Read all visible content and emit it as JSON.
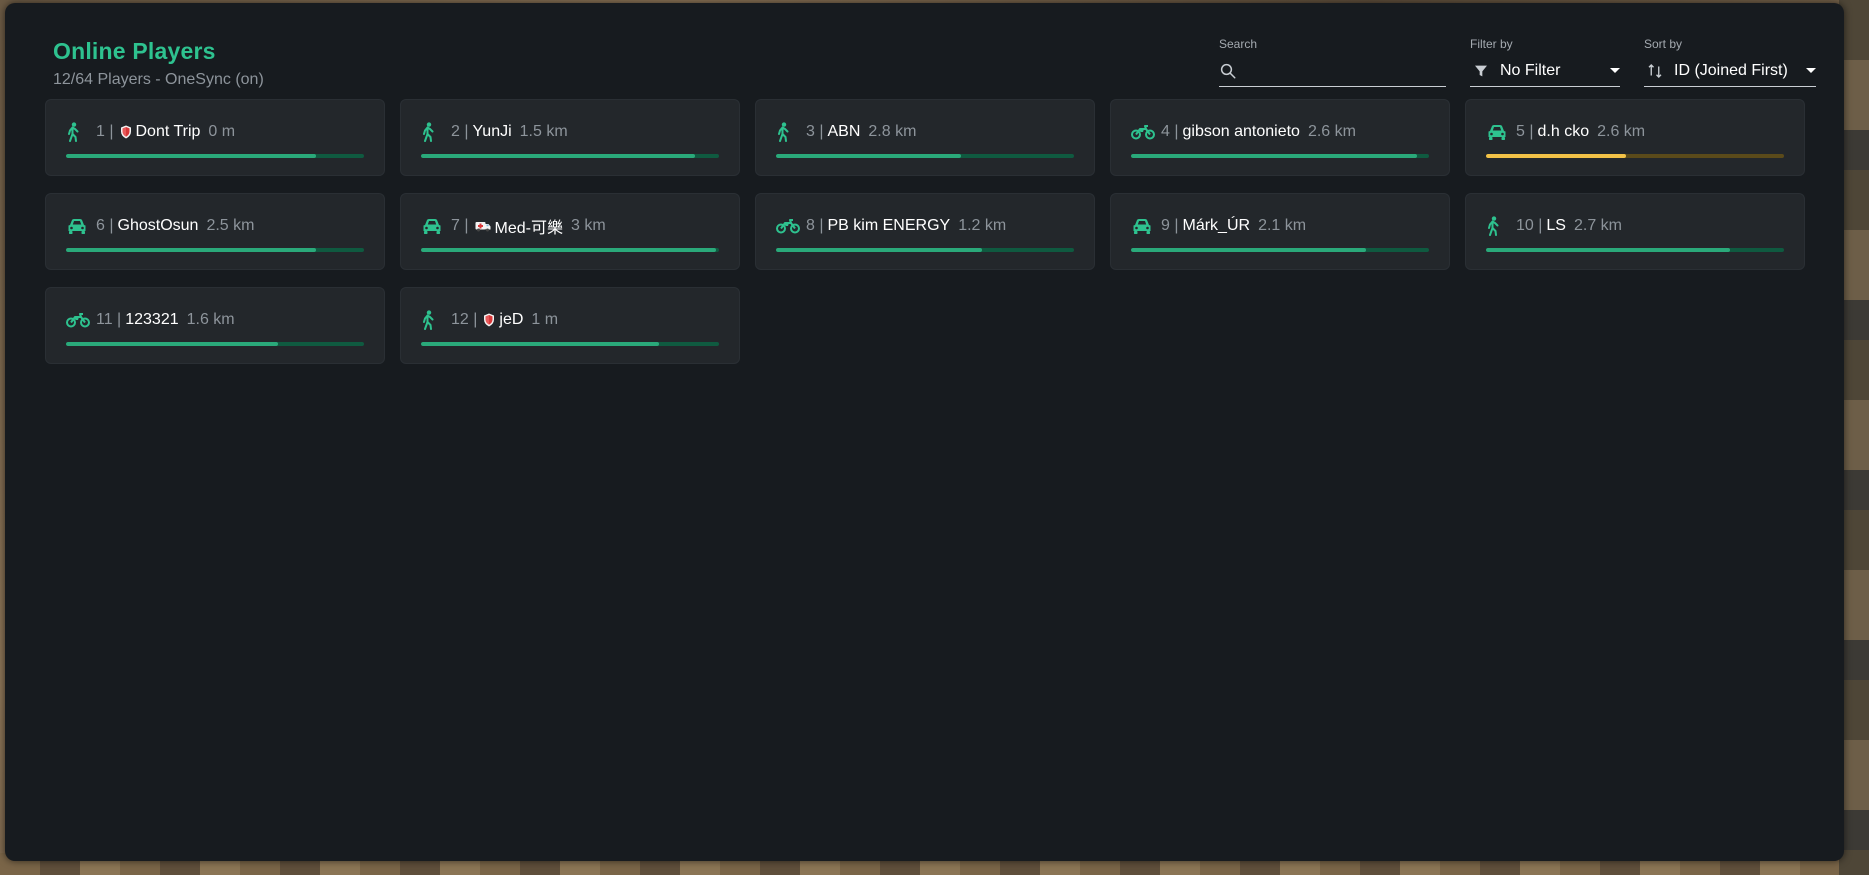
{
  "header": {
    "title": "Online Players",
    "subtitle": "12/64 Players - OneSync (on)"
  },
  "controls": {
    "search": {
      "label": "Search",
      "placeholder": "",
      "value": ""
    },
    "filter": {
      "label": "Filter by",
      "value": "No Filter"
    },
    "sort": {
      "label": "Sort by",
      "value": "ID (Joined First)"
    }
  },
  "colors": {
    "accent": "#2ec28f",
    "health_ok": "#2aa97a",
    "health_warn": "#f2c247",
    "panel": "#171b1f",
    "card": "#23272b"
  },
  "players": [
    {
      "id": "1 |",
      "name": "Dont Trip",
      "distance": "0 m",
      "vehicle": "walking-icon",
      "badge": "shield-badge-icon",
      "health": 0.84,
      "status": "ok"
    },
    {
      "id": "2 |",
      "name": "YunJi",
      "distance": "1.5 km",
      "vehicle": "walking-icon",
      "badge": null,
      "health": 0.92,
      "status": "ok"
    },
    {
      "id": "3 |",
      "name": "ABN",
      "distance": "2.8 km",
      "vehicle": "walking-icon",
      "badge": null,
      "health": 0.62,
      "status": "ok"
    },
    {
      "id": "4 |",
      "name": "gibson antonieto",
      "distance": "2.6 km",
      "vehicle": "motorcycle-icon",
      "badge": null,
      "health": 0.96,
      "status": "ok"
    },
    {
      "id": "5 |",
      "name": "d.h cko",
      "distance": "2.6 km",
      "vehicle": "car-icon",
      "badge": null,
      "health": 0.47,
      "status": "warn"
    },
    {
      "id": "6 |",
      "name": "GhostOsun",
      "distance": "2.5 km",
      "vehicle": "car-icon",
      "badge": null,
      "health": 0.84,
      "status": "ok"
    },
    {
      "id": "7 |",
      "name": "Med-可樂",
      "distance": "3 km",
      "vehicle": "car-icon",
      "badge": "ambulance-badge-icon",
      "health": 0.99,
      "status": "ok"
    },
    {
      "id": "8 |",
      "name": "PB kim ENERGY",
      "distance": "1.2 km",
      "vehicle": "motorcycle-icon",
      "badge": null,
      "health": 0.69,
      "status": "ok"
    },
    {
      "id": "9 |",
      "name": "Márk_ÚR",
      "distance": "2.1 km",
      "vehicle": "car-icon",
      "badge": null,
      "health": 0.79,
      "status": "ok"
    },
    {
      "id": "10 |",
      "name": "LS",
      "distance": "2.7 km",
      "vehicle": "walking-icon",
      "badge": null,
      "health": 0.82,
      "status": "ok"
    },
    {
      "id": "11 |",
      "name": "123321",
      "distance": "1.6 km",
      "vehicle": "motorcycle-icon",
      "badge": null,
      "health": 0.71,
      "status": "ok"
    },
    {
      "id": "12 |",
      "name": "jeD",
      "distance": "1 m",
      "vehicle": "walking-icon",
      "badge": "shield-badge-icon",
      "health": 0.8,
      "status": "ok"
    }
  ]
}
